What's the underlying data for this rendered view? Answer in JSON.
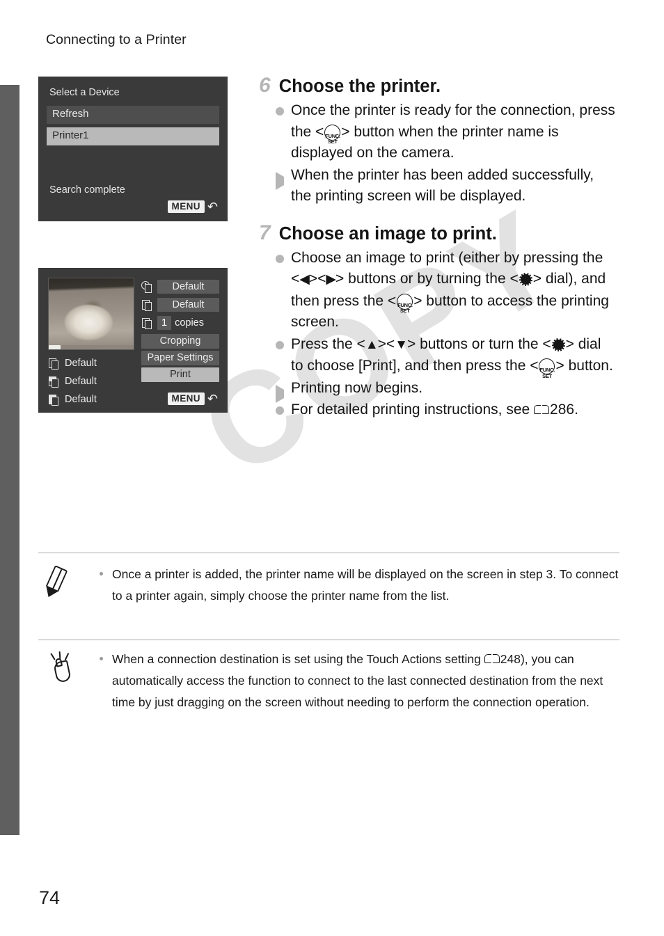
{
  "page": {
    "running_head": "Connecting to a Printer",
    "folio": "74",
    "watermark": "COPY"
  },
  "figures": {
    "select_device_screen": {
      "title": "Select a Device",
      "rows": [
        {
          "label": "Refresh",
          "selected": false
        },
        {
          "label": "Printer1",
          "selected": true
        }
      ],
      "status": "Search complete",
      "menu_badge": "MENU",
      "back_arrow": "↶"
    },
    "print_settings_screen": {
      "thumbnail_alt": "dog-photo-thumbnail",
      "left_items": [
        {
          "icon": "paper-size-icon",
          "label": "Default"
        },
        {
          "icon": "paper-type-icon",
          "label": "Default"
        },
        {
          "icon": "page-layout-icon",
          "label": "Default"
        }
      ],
      "right_rows": [
        {
          "icon": "date-imprint-icon",
          "value": "Default"
        },
        {
          "icon": "image-optimize-icon",
          "value": "Default"
        }
      ],
      "copies": {
        "icon": "copies-icon",
        "count": "1",
        "label": "copies"
      },
      "buttons": [
        {
          "label": "Cropping",
          "active": false
        },
        {
          "label": "Paper Settings",
          "active": false
        },
        {
          "label": "Print",
          "active": true
        }
      ],
      "menu_badge": "MENU",
      "back_arrow": "↶"
    }
  },
  "steps": [
    {
      "number": "6",
      "title": "Choose the printer.",
      "bullets": [
        {
          "marker": "dot",
          "parts": [
            {
              "t": "text",
              "v": "Once the printer is ready for the connection, press the <"
            },
            {
              "t": "func_set_button"
            },
            {
              "t": "text",
              "v": "> button when the printer name is displayed on the camera."
            }
          ]
        },
        {
          "marker": "triangle",
          "parts": [
            {
              "t": "text",
              "v": "When the printer has been added successfully, the printing screen will be displayed."
            }
          ]
        }
      ]
    },
    {
      "number": "7",
      "title": "Choose an image to print.",
      "bullets": [
        {
          "marker": "dot",
          "parts": [
            {
              "t": "text",
              "v": "Choose an image to print (either by pressing the <"
            },
            {
              "t": "arrow",
              "v": "◀"
            },
            {
              "t": "text",
              "v": "><"
            },
            {
              "t": "arrow",
              "v": "▶"
            },
            {
              "t": "text",
              "v": "> buttons or by turning the <"
            },
            {
              "t": "dial"
            },
            {
              "t": "text",
              "v": "> dial), and then press the <"
            },
            {
              "t": "func_set_button"
            },
            {
              "t": "text",
              "v": "> button to access the printing screen."
            }
          ]
        },
        {
          "marker": "dot",
          "parts": [
            {
              "t": "text",
              "v": "Press the <"
            },
            {
              "t": "arrow",
              "v": "▲"
            },
            {
              "t": "text",
              "v": "><"
            },
            {
              "t": "arrow",
              "v": "▼"
            },
            {
              "t": "text",
              "v": "> buttons or turn the <"
            },
            {
              "t": "dial"
            },
            {
              "t": "text",
              "v": "> dial to choose [Print], and then press the <"
            },
            {
              "t": "func_set_button"
            },
            {
              "t": "text",
              "v": "> button."
            }
          ]
        },
        {
          "marker": "triangle",
          "parts": [
            {
              "t": "text",
              "v": "Printing now begins."
            }
          ]
        },
        {
          "marker": "dot",
          "parts": [
            {
              "t": "text",
              "v": "For detailed printing instructions, see "
            },
            {
              "t": "book_ref",
              "v": "286"
            },
            {
              "t": "text",
              "v": "."
            }
          ]
        }
      ]
    }
  ],
  "func_set_button": {
    "line1": "FUNC.",
    "line2": "SET"
  },
  "notes": [
    {
      "icon": "pencil-icon",
      "text": "Once a printer is added, the printer name will be displayed on the screen in step 3. To connect to a printer again, simply choose the printer name from the list."
    },
    {
      "icon": "touch-finger-icon",
      "text_before_ref": "When a connection destination is set using the Touch Actions setting ",
      "book_ref": "248",
      "text_after_ref": "), you can automatically access the function to connect to the last connected destination from the next time by just dragging on the screen without needing to perform the connection operation."
    }
  ]
}
